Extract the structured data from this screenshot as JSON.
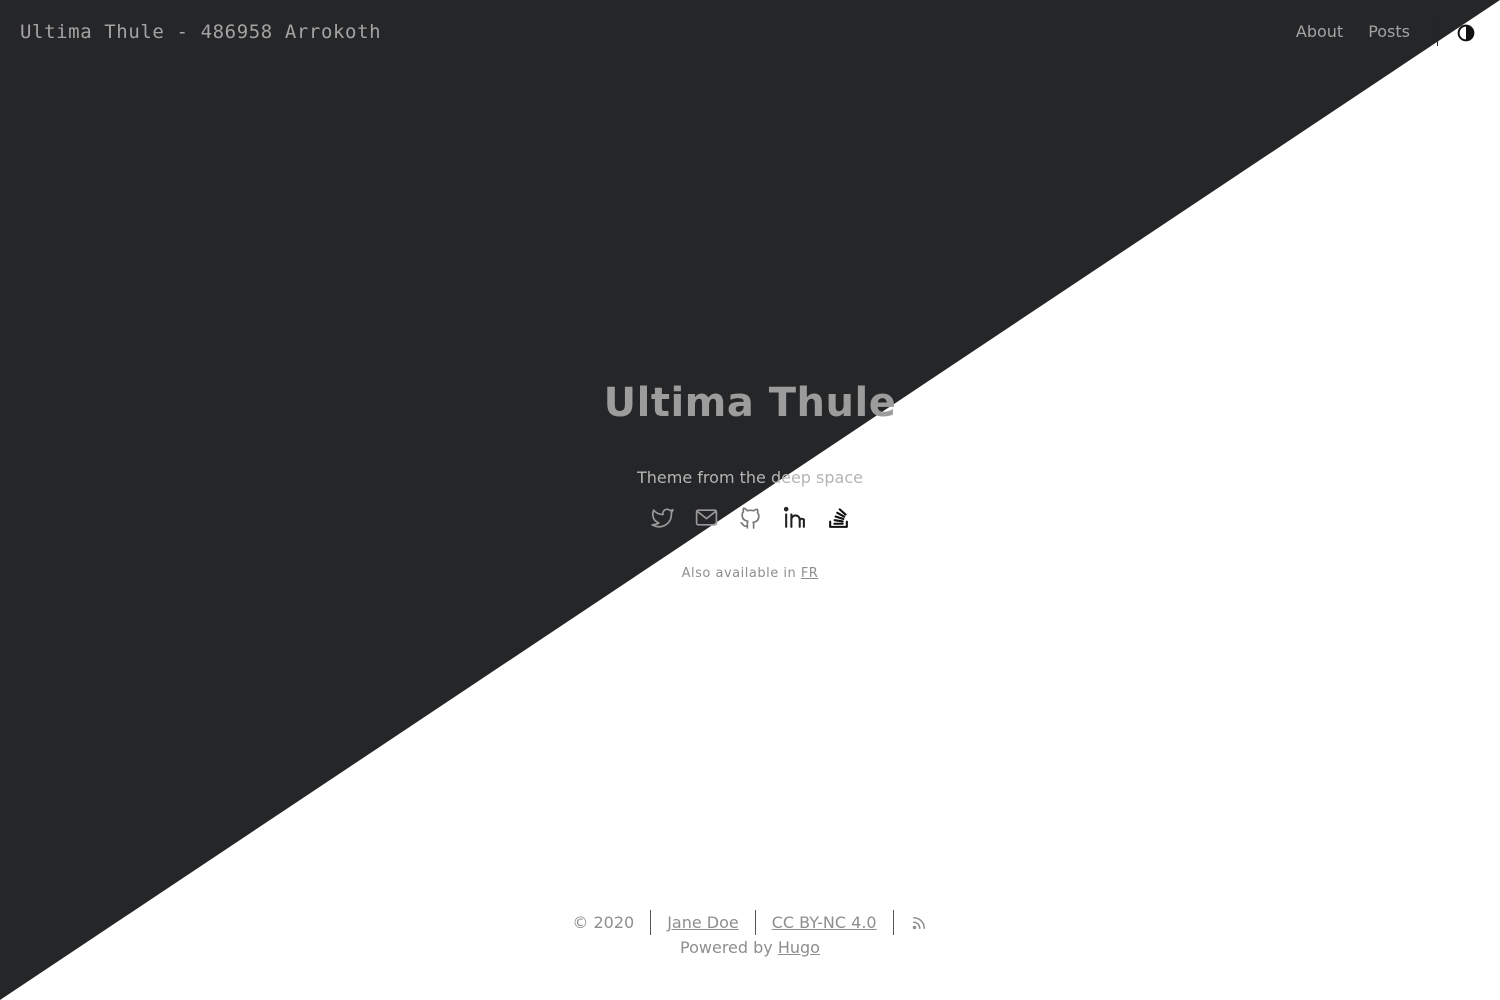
{
  "header": {
    "site_title": "Ultima Thule - 486958 Arrokoth",
    "nav": [
      {
        "label": "About"
      },
      {
        "label": "Posts"
      }
    ],
    "theme_toggle_icon": "contrast-icon"
  },
  "hero": {
    "title": "Ultima Thule",
    "subtitle": "Theme from the deep space",
    "social_icons": [
      "twitter-icon",
      "mail-icon",
      "github-icon",
      "linkedin-icon",
      "stackoverflow-icon"
    ],
    "lang_prefix": "Also available in",
    "lang_link": "FR"
  },
  "footer": {
    "copyright": "© 2020",
    "author": "Jane Doe",
    "license": "CC BY-NC 4.0",
    "rss_icon": "rss-icon",
    "powered_prefix": "Powered by",
    "powered_link": "Hugo"
  },
  "colors": {
    "dark_bg": "#252628",
    "light_bg": "#ffffff",
    "text_muted": "#a3a3a3"
  }
}
